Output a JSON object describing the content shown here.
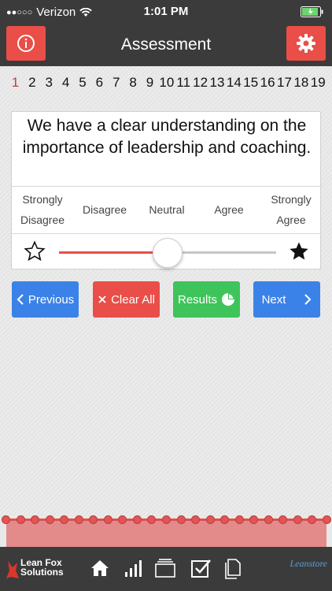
{
  "status_bar": {
    "signal_dots": "●●○○○",
    "carrier": "Verizon",
    "time": "1:01 PM"
  },
  "nav": {
    "title": "Assessment",
    "left_icon": "info-icon",
    "right_icon": "gear-icon"
  },
  "question_numbers": [
    "1",
    "2",
    "3",
    "4",
    "5",
    "6",
    "7",
    "8",
    "9",
    "10",
    "11",
    "12",
    "13",
    "14",
    "15",
    "16",
    "17",
    "18",
    "19"
  ],
  "active_question": "1",
  "question": {
    "text": "We have a clear understanding on the importance of leadership and coaching."
  },
  "scale_labels": [
    "Strongly Disagree",
    "Disagree",
    "Neutral",
    "Agree",
    "Strongly Agree"
  ],
  "slider": {
    "value_fraction": 0.5
  },
  "buttons": {
    "previous": "Previous",
    "clear_all": "Clear All",
    "results": "Results",
    "next": "Next"
  },
  "progress": {
    "dot_count": 23
  },
  "tab_bar": {
    "logo_left_line1": "Lean Fox",
    "logo_left_line2": "Solutions",
    "logo_right": "Leanstore"
  },
  "colors": {
    "bar": "#3b3b3b",
    "accent_red": "#e94e48",
    "blue": "#3b82e8",
    "green": "#3ec45a"
  }
}
